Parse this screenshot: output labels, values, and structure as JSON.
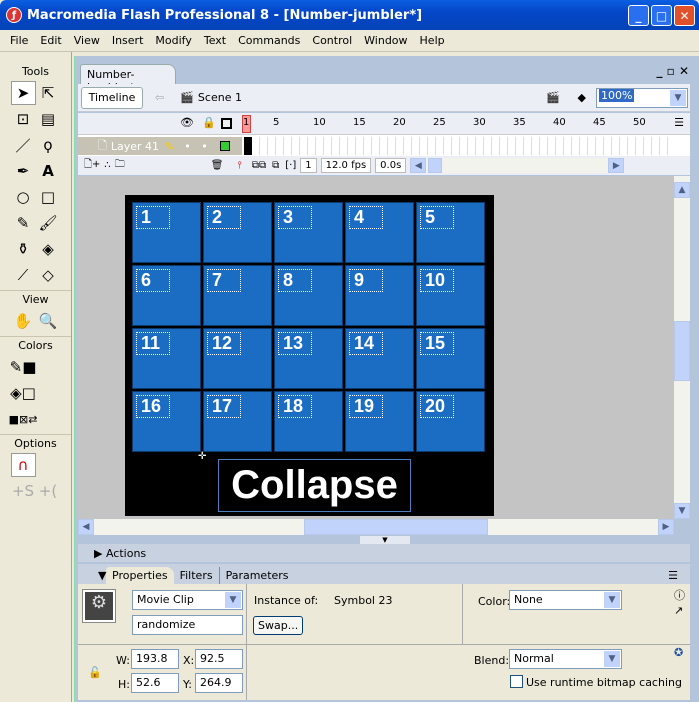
{
  "window": {
    "title": "Macromedia Flash Professional 8 - [Number-jumbler*]"
  },
  "menu": [
    "File",
    "Edit",
    "View",
    "Insert",
    "Modify",
    "Text",
    "Commands",
    "Control",
    "Window",
    "Help"
  ],
  "tools": {
    "title": "Tools",
    "view_title": "View",
    "colors_title": "Colors",
    "options_title": "Options"
  },
  "document": {
    "tab": "Number-jumbler*",
    "timeline_button": "Timeline",
    "scene": "Scene 1",
    "zoom": "100%"
  },
  "timeline": {
    "frame_numbers": [
      "1",
      "5",
      "10",
      "15",
      "20",
      "25",
      "30",
      "35",
      "40",
      "45",
      "50"
    ],
    "layer": "Layer 41",
    "current_frame": "1",
    "fps": "12.0 fps",
    "time": "0.0s"
  },
  "stage": {
    "tiles": [
      "1",
      "2",
      "3",
      "4",
      "5",
      "6",
      "7",
      "8",
      "9",
      "10",
      "11",
      "12",
      "13",
      "14",
      "15",
      "16",
      "17",
      "18",
      "19",
      "20"
    ],
    "button_text": "Collapse",
    "tile_color": "#1b6dc4"
  },
  "panels": {
    "actions": "Actions",
    "tabs": [
      "Properties",
      "Filters",
      "Parameters"
    ]
  },
  "properties": {
    "symbol_type": "Movie Clip",
    "instance_name": "randomize",
    "instance_of_label": "Instance of:",
    "instance_of": "Symbol 23",
    "swap": "Swap...",
    "color_label": "Color:",
    "color": "None",
    "blend_label": "Blend:",
    "blend": "Normal",
    "cache_label": "Use runtime bitmap caching",
    "w_label": "W:",
    "w": "193.8",
    "h_label": "H:",
    "h": "52.6",
    "x_label": "X:",
    "x": "92.5",
    "y_label": "Y:",
    "y": "264.9"
  }
}
